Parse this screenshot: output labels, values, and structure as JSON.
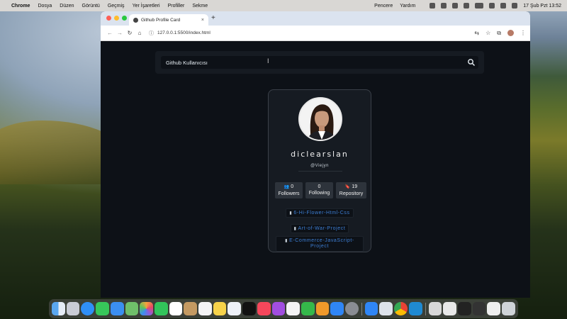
{
  "menubar": {
    "app": "Chrome",
    "items": [
      "Dosya",
      "Düzen",
      "Görüntü",
      "Geçmiş",
      "Yer İşaretleri",
      "Profiller",
      "Sekme"
    ],
    "right_items": [
      "Pencere",
      "Yardım"
    ],
    "datetime": "17 Şub Pzt  13:52"
  },
  "browser": {
    "tab_title": "Github Profile Card",
    "url": "127.0.0.1:5500/index.html"
  },
  "search": {
    "value": "Github Kullanıcısı",
    "placeholder": "Github Kullanıcısı"
  },
  "profile": {
    "username": "diclearslan",
    "handle": "@Viejyn",
    "stats": [
      {
        "icon": "users-icon",
        "count": "0",
        "label": "Followers"
      },
      {
        "icon": "",
        "count": "0",
        "label": "Following"
      },
      {
        "icon": "bookmark-icon",
        "count": "19",
        "label": "Repository"
      }
    ],
    "repos": [
      "6-Hi-Flower-Html-Css",
      "Art-of-War-Project",
      "E-Commerce-JavaScript-Project"
    ]
  },
  "colors": {
    "page_bg": "#0d1117",
    "card_bg": "#161b22",
    "repo_link": "#3d7fd6"
  }
}
